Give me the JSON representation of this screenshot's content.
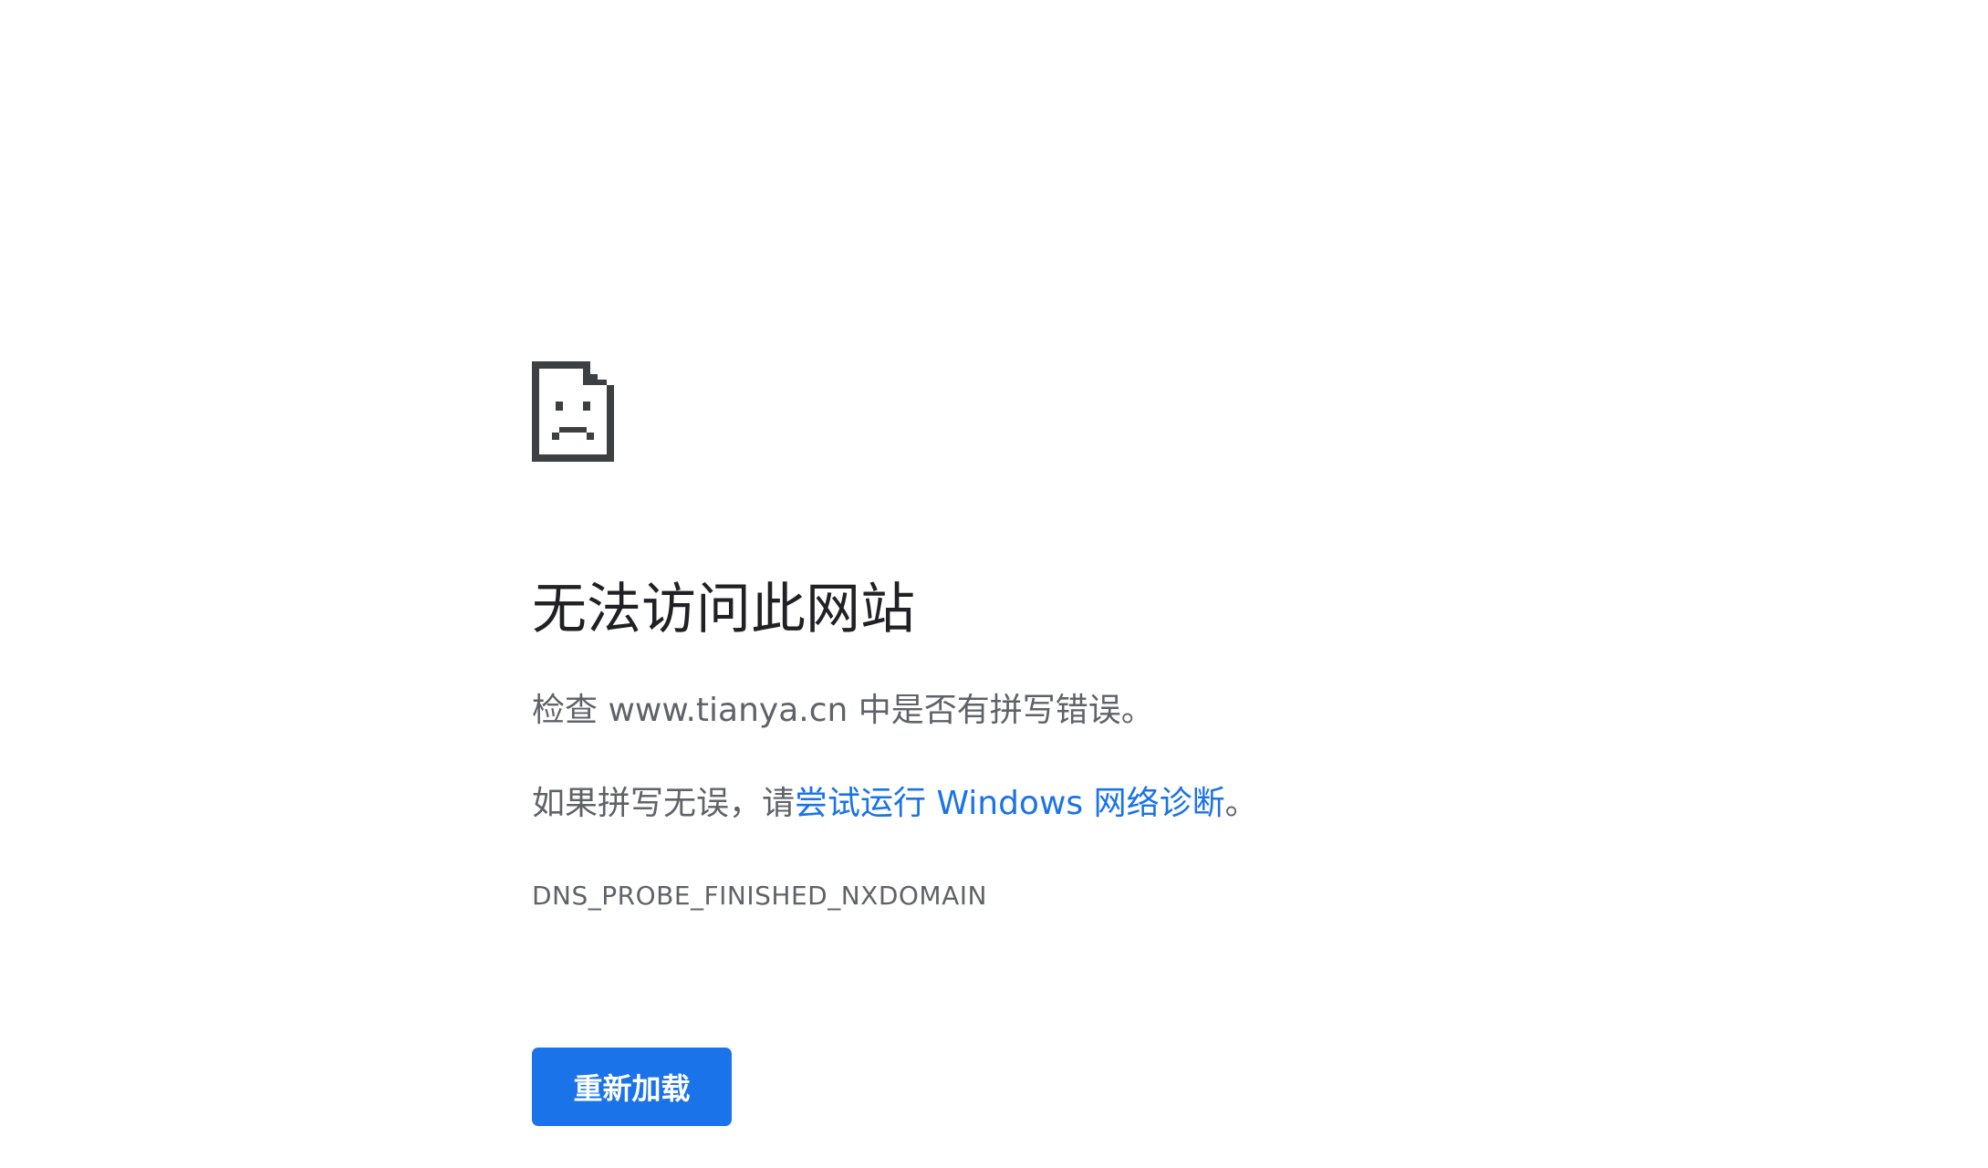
{
  "error_page": {
    "title": "无法访问此网站",
    "check_prefix": "检查 ",
    "domain": "www.tianya.cn",
    "check_suffix": " 中是否有拼写错误。",
    "suggestion_prefix": "如果拼写无误，请",
    "diagnostics_link": "尝试运行 Windows 网络诊断",
    "suggestion_suffix": "。",
    "error_code": "DNS_PROBE_FINISHED_NXDOMAIN",
    "reload_label": "重新加载"
  },
  "icons": {
    "error": "sad-page-icon"
  },
  "colors": {
    "button": "#1a73e8",
    "link": "#1a73e8",
    "text": "#5f6368",
    "title": "#202124"
  }
}
